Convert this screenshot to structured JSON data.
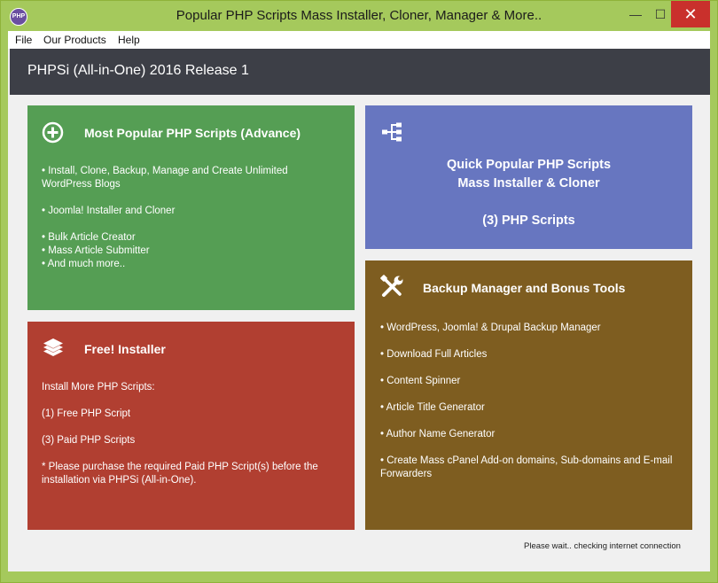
{
  "window": {
    "icon_label": "PHP",
    "title": "Popular PHP Scripts Mass Installer, Cloner, Manager & More..",
    "min_glyph": "—",
    "max_glyph": "☐",
    "close_glyph": "✕"
  },
  "menu": [
    "File",
    "Our Products",
    "Help"
  ],
  "header": {
    "title": "PHPSi (All-in-One) 2016 Release 1"
  },
  "tiles": {
    "popular": {
      "title": "Most Popular PHP Scripts (Advance)",
      "icon": "plus-circle-icon",
      "lines": [
        "• Install, Clone, Backup, Manage and Create Unlimited",
        "WordPress Blogs",
        "• Joomla! Installer and Cloner",
        "• Bulk Article Creator",
        "• Mass Article Submitter",
        "• And much more.."
      ]
    },
    "free": {
      "title": "Free! Installer",
      "icon": "layers-icon",
      "lines": [
        "Install More PHP Scripts:",
        "(1) Free PHP Script",
        "(3) Paid PHP Scripts",
        "* Please purchase the required Paid PHP Script(s) before the",
        "installation via PHPSi (All-in-One)."
      ]
    },
    "quick": {
      "icon": "network-tree-icon",
      "line1": "Quick Popular PHP Scripts",
      "line2": "Mass Installer & Cloner",
      "line3": "(3) PHP Scripts"
    },
    "backup": {
      "title": "Backup Manager and Bonus Tools",
      "icon": "tools-icon",
      "lines": [
        "• WordPress, Joomla! & Drupal Backup Manager",
        "• Download Full Articles",
        "• Content Spinner",
        "• Article Title Generator",
        "• Author Name Generator",
        "• Create Mass cPanel Add-on domains, Sub-domains and E-mail",
        "Forwarders"
      ]
    }
  },
  "status": "Please wait.. checking internet connection",
  "colors": {
    "frame": "#a5c95c",
    "header": "#3d3f47",
    "green": "#559e54",
    "red": "#b13f31",
    "blue": "#6776c0",
    "brown": "#7e5d20"
  }
}
